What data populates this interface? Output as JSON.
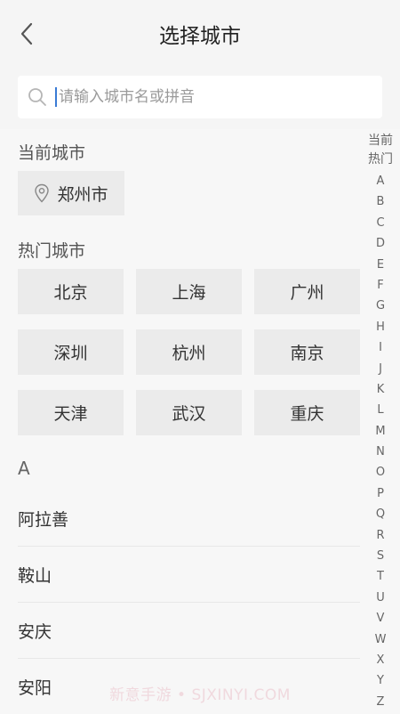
{
  "header": {
    "title": "选择城市",
    "back_icon": "chevron-left-icon"
  },
  "search": {
    "placeholder": "请输入城市名或拼音",
    "value": "",
    "icon": "search-icon"
  },
  "current_city": {
    "label": "当前城市",
    "city": "郑州市",
    "icon": "location-pin-icon"
  },
  "hot_cities": {
    "label": "热门城市",
    "items": [
      "北京",
      "上海",
      "广州",
      "深圳",
      "杭州",
      "南京",
      "天津",
      "武汉",
      "重庆"
    ]
  },
  "city_list": {
    "letter": "A",
    "items": [
      "阿拉善",
      "鞍山",
      "安庆",
      "安阳"
    ]
  },
  "index_bar": {
    "top_line1": "当前",
    "top_line2": "热门",
    "letters": [
      "A",
      "B",
      "C",
      "D",
      "E",
      "F",
      "G",
      "H",
      "I",
      "J",
      "K",
      "L",
      "M",
      "N",
      "O",
      "P",
      "Q",
      "R",
      "S",
      "T",
      "U",
      "V",
      "W",
      "X",
      "Y",
      "Z"
    ]
  },
  "watermark": "新意手游 • SJXINYI.COM",
  "colors": {
    "cursor": "#3a7bd5",
    "button_bg": "#ebebeb",
    "page_bg": "#f7f7f7"
  }
}
